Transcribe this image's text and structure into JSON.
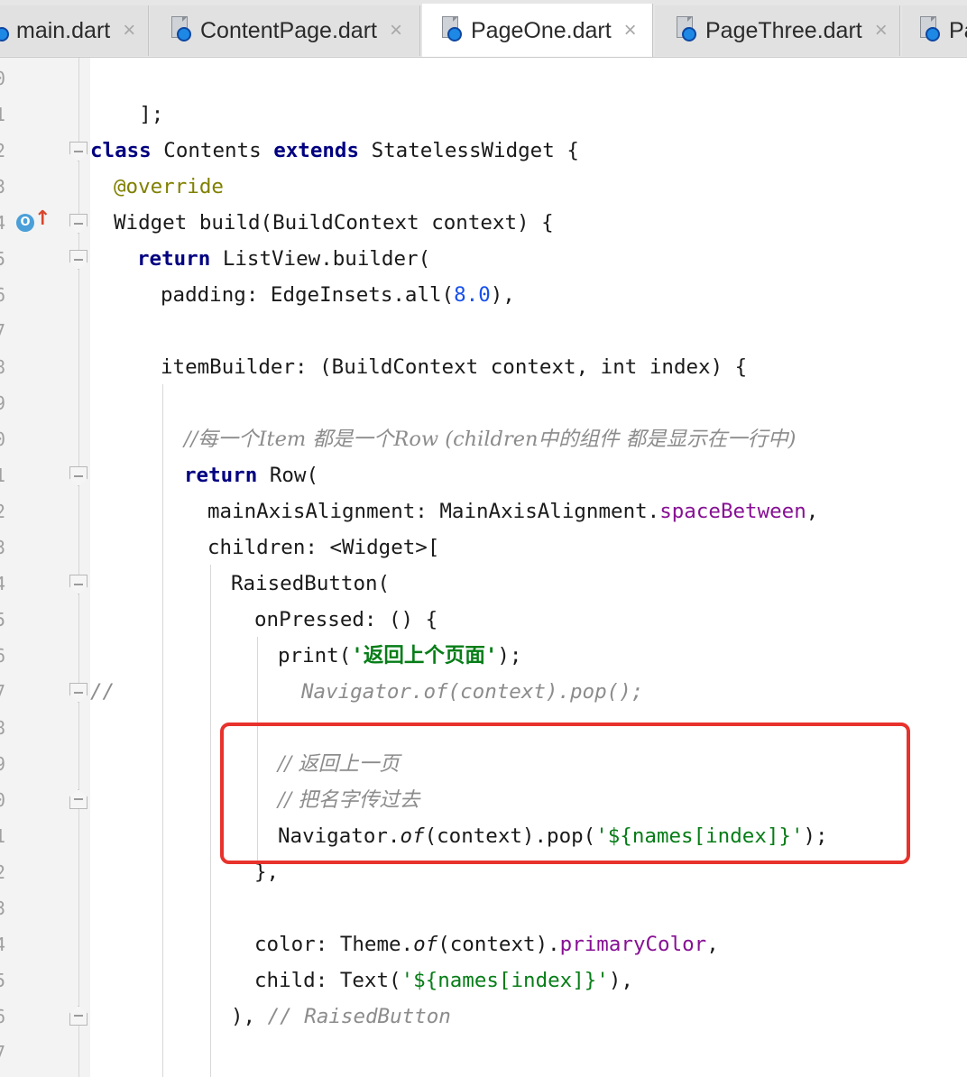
{
  "tabs": [
    {
      "label": "main.dart",
      "close": "×",
      "active": false
    },
    {
      "label": "ContentPage.dart",
      "close": "×",
      "active": false
    },
    {
      "label": "PageOne.dart",
      "close": "×",
      "active": true
    },
    {
      "label": "PageThree.dart",
      "close": "×",
      "active": false
    },
    {
      "label": "Pa",
      "close": "",
      "active": false
    }
  ],
  "gutter": {
    "line_numbers": [
      "0",
      "1",
      "2",
      "3",
      "4",
      "5",
      "6",
      "7",
      "8",
      "9",
      "0",
      "1",
      "2",
      "3",
      "4",
      "5",
      "6",
      "7",
      "8",
      "9",
      "0",
      "1",
      "2",
      "3",
      "4",
      "5",
      "6",
      "7"
    ],
    "override_badge": "O",
    "override_arrow": "↑"
  },
  "code": {
    "l1": "];",
    "l3_kw1": "class",
    "l3_mid": " Contents ",
    "l3_kw2": "extends",
    "l3_end": " StatelessWidget {",
    "l4": "@override",
    "l5": "Widget build(BuildContext context) {",
    "l6_kw": "return",
    "l6_end": " ListView.builder(",
    "l7_a": "padding: EdgeInsets.all(",
    "l7_num": "8.0",
    "l7_b": "),",
    "l9": "itemBuilder: (BuildContext context, int index) {",
    "l11": "//每一个Item 都是一个Row (children中的组件 都是显示在一行中)",
    "l12_kw": "return",
    "l12_end": " Row(",
    "l13_a": "mainAxisAlignment: MainAxisAlignment.",
    "l13_field": "spaceBetween",
    "l13_b": ",",
    "l14": "children: <Widget>[",
    "l15": "RaisedButton(",
    "l16": "onPressed: () {",
    "l17_a": "print(",
    "l17_str": "'返回上个页面'",
    "l17_b": ");",
    "l18_prefix": "//",
    "l18": "Navigator.of(context).pop();",
    "l20": "// 返回上一页",
    "l21": "// 把名字传过去",
    "l22_a": "Navigator.",
    "l22_of": "of",
    "l22_b": "(context).pop(",
    "l22_str": "'${names[index]}'",
    "l22_c": ");",
    "l23": "},",
    "l25_a": "color: Theme.",
    "l25_of": "of",
    "l25_b": "(context).",
    "l25_field": "primaryColor",
    "l25_c": ",",
    "l26_a": "child: Text(",
    "l26_str": "'${names[index]}'",
    "l26_b": "),",
    "l27_a": "), ",
    "l27_cmt": "// RaisedButton"
  },
  "colors": {
    "keyword": "#000080",
    "annotation": "#808000",
    "number": "#1750eb",
    "field": "#871094",
    "string": "#067d17",
    "comment": "#8c8c8c",
    "highlight_border": "#e8322c"
  }
}
